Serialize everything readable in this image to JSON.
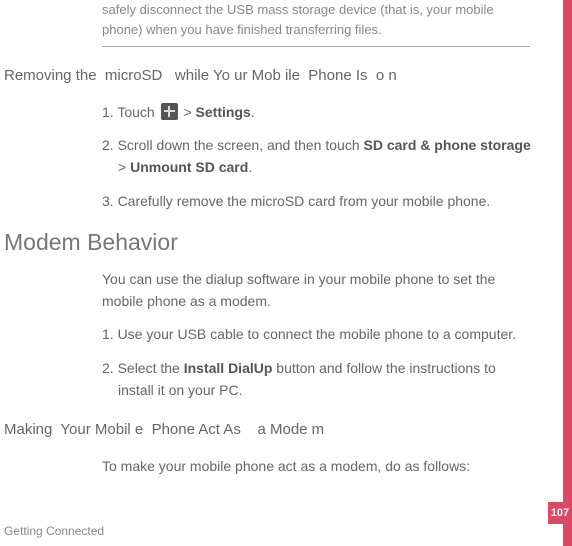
{
  "note": "safely disconnect the USB mass storage device (that is, your mobile phone) when you have finished transferring files.",
  "subhead1": "Removing the  microSD   while Yo ur Mob ile  Phone Is  o n",
  "list1": {
    "item1a": "1. Touch ",
    "item1b": " > ",
    "item1c": "Settings",
    "item1d": ".",
    "item2a": "2. Scroll down the screen, and then touch ",
    "item2b": "SD card & phone storage",
    "item2c": " > ",
    "item2d": "Unmount SD card",
    "item2e": ".",
    "item3": "3. Carefully remove the microSD card from your mobile phone."
  },
  "heading2": "Modem Behavior",
  "para1": "You can use the dialup software in your mobile phone to set the mobile phone as a modem.",
  "list2": {
    "item1": "1. Use your USB cable to connect the mobile phone to a computer.",
    "item2a": "2. Select the ",
    "item2b": "Install DialUp",
    "item2c": " button and follow the instructions to install it on your PC."
  },
  "subhead2": "Making  Your Mobil e  Phone Act As    a Mode m",
  "para2": "To make your mobile phone act as a modem, do as follows:",
  "footer": "Getting Connected",
  "pagenum": "107"
}
